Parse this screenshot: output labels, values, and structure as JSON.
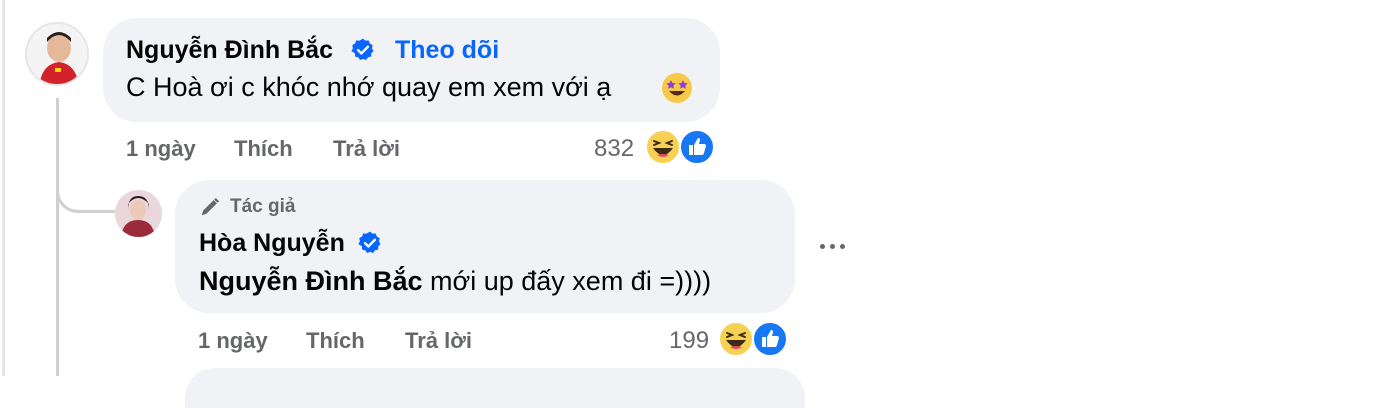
{
  "comment": {
    "author": "Nguyễn Đình Bắc",
    "follow_label": "Theo dõi",
    "text": "C Hoà ơi c khóc nhớ quay em xem với ạ",
    "time": "1 ngày",
    "like_label": "Thích",
    "reply_label": "Trả lời",
    "reaction_count": "832",
    "emoji": "star-struck-emoji-icon",
    "reactions": [
      "haha-reaction-icon",
      "like-reaction-icon"
    ]
  },
  "reply": {
    "author_badge": "Tác giả",
    "author": "Hòa Nguyễn",
    "mention": "Nguyễn Đình Bắc",
    "text": " mới up đấy xem đi =))))",
    "time": "1 ngày",
    "like_label": "Thích",
    "reply_label": "Trả lời",
    "reaction_count": "199",
    "reactions": [
      "haha-reaction-icon",
      "like-reaction-icon"
    ]
  },
  "colors": {
    "bubble": "#f0f2f5",
    "link": "#0866ff",
    "meta": "#65676b",
    "verified": "#0866ff",
    "like": "#1877f2",
    "haha": "#f7d154"
  }
}
